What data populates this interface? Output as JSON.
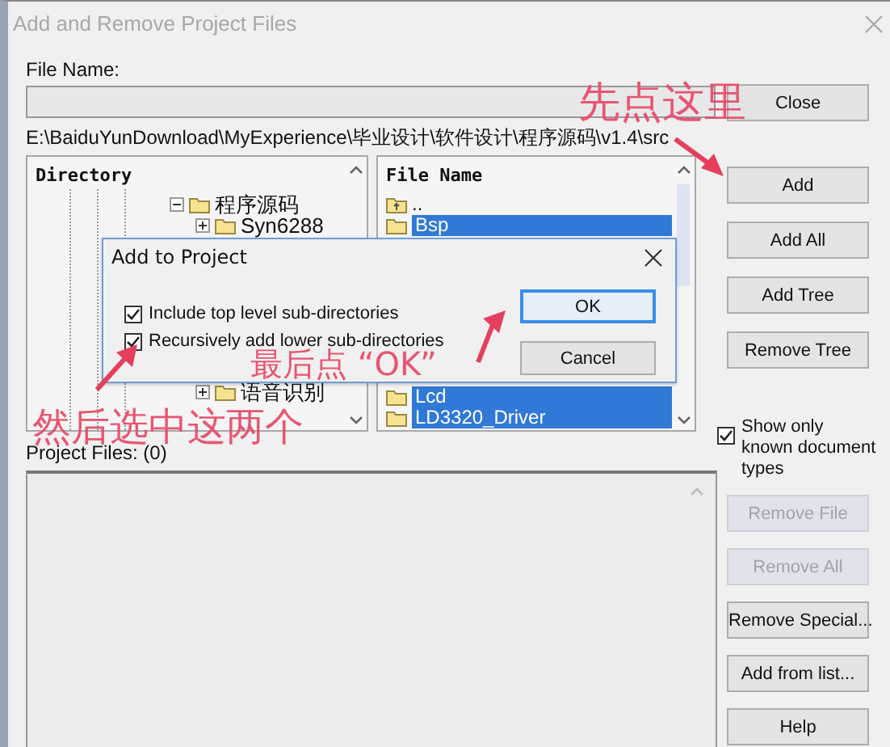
{
  "window": {
    "title": "Add and Remove Project Files"
  },
  "file_name": {
    "label": "File Name:"
  },
  "current_path": "E:\\BaiduYunDownload\\MyExperience\\毕业设计\\软件设计\\程序源码\\v1.4\\src",
  "directory": {
    "header": "Directory",
    "tree": [
      {
        "label": "程序源码",
        "expanded": true,
        "children": [
          {
            "label": "Syn6288",
            "expanded": false
          },
          {
            "label": "语音识别",
            "expanded": false
          }
        ]
      }
    ]
  },
  "files": {
    "header": "File Name",
    "items": [
      {
        "kind": "up",
        "label": "..",
        "selected": false
      },
      {
        "kind": "folder",
        "label": "Bsp",
        "selected": true
      },
      {
        "kind": "folder",
        "label": "Lcd",
        "selected": true
      },
      {
        "kind": "folder",
        "label": "LD3320_Driver",
        "selected": true
      }
    ]
  },
  "buttons_top": [
    {
      "label": "Close",
      "disabled": false
    },
    {
      "label": "Add",
      "disabled": false
    },
    {
      "label": "Add All",
      "disabled": false
    },
    {
      "label": "Add Tree",
      "disabled": false
    },
    {
      "label": "Remove Tree",
      "disabled": false
    }
  ],
  "show_known_types": {
    "label": "Show only known document types",
    "checked": true
  },
  "buttons_bottom": [
    {
      "label": "Remove File",
      "disabled": true
    },
    {
      "label": "Remove All",
      "disabled": true
    },
    {
      "label": "Remove Special...",
      "disabled": false
    },
    {
      "label": "Add from list...",
      "disabled": false
    },
    {
      "label": "Help",
      "disabled": false
    }
  ],
  "project_files": {
    "label": "Project Files: (0)"
  },
  "dialog": {
    "title": "Add to Project",
    "options": [
      {
        "label": "Include top level sub-directories",
        "checked": true
      },
      {
        "label": "Recursively add lower sub-directories",
        "checked": true
      }
    ],
    "ok": "OK",
    "cancel": "Cancel"
  },
  "annotations": [
    {
      "text": "先点这里"
    },
    {
      "text": "然后选中这两个"
    },
    {
      "text": "最后点 “OK”"
    }
  ]
}
